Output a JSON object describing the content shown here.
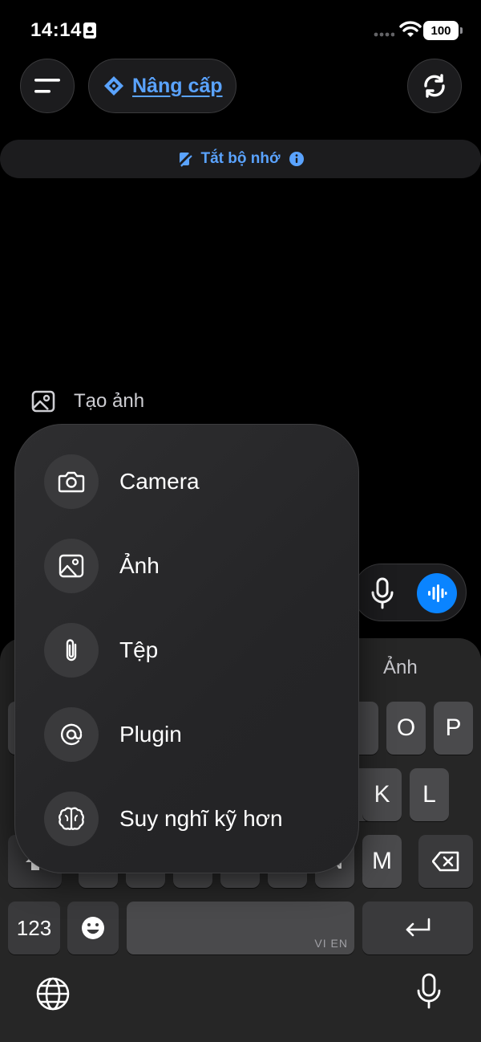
{
  "status_bar": {
    "time": "14:14",
    "battery": "100"
  },
  "header": {
    "upgrade_label": "Nâng cấp"
  },
  "memory_bar": {
    "label": "Tắt bộ nhớ"
  },
  "create_image": {
    "label": "Tạo ảnh"
  },
  "attachment_menu": {
    "items": [
      {
        "label": "Camera",
        "icon": "camera-icon"
      },
      {
        "label": "Ảnh",
        "icon": "photo-icon"
      },
      {
        "label": "Tệp",
        "icon": "paperclip-icon"
      },
      {
        "label": "Plugin",
        "icon": "plugin-icon"
      },
      {
        "label": "Suy nghĩ kỹ hơn",
        "icon": "brain-icon"
      }
    ]
  },
  "keyboard": {
    "suggestion": "Ảnh",
    "keys": {
      "o": "O",
      "p": "P",
      "k": "K",
      "l": "L",
      "m": "M",
      "n": "N",
      "numbers": "123"
    },
    "space_label": "VI EN"
  },
  "colors": {
    "accent": "#0a84ff",
    "link": "#5aa3ff",
    "background": "#000000"
  }
}
